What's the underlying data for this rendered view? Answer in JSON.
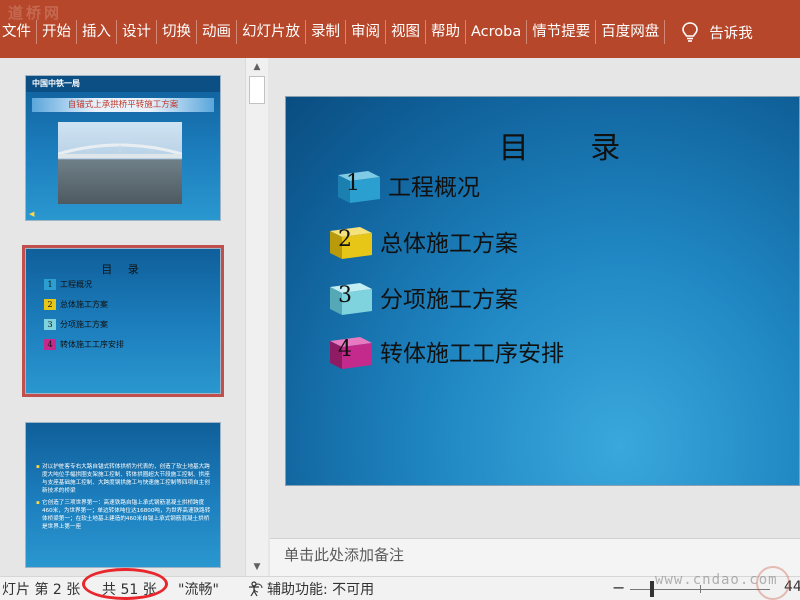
{
  "ribbon": {
    "watermark": "道桥网",
    "tabs": [
      "文件",
      "开始",
      "插入",
      "设计",
      "切换",
      "动画",
      "幻灯片放",
      "录制",
      "审阅",
      "视图",
      "帮助",
      "Acroba",
      "情节提要",
      "百度网盘"
    ],
    "tell_me": "告诉我",
    "color": "#b7472a"
  },
  "thumbnails": {
    "slide1": {
      "header": "中国中铁一局",
      "banner": "自锚式上承拱桥平转施工方案"
    },
    "slide2": {
      "title": "目 录",
      "items": [
        {
          "num": "1",
          "text": "工程概况"
        },
        {
          "num": "2",
          "text": "总体施工方案"
        },
        {
          "num": "3",
          "text": "分项施工方案"
        },
        {
          "num": "4",
          "text": "转体施工工序安排"
        }
      ]
    },
    "slide3": {
      "bullets": [
        "对以护桩客专右大路自锚式转体拱桥为代表的，创造了软土地基大跨度大吨位手幅拱圈支架施工控制、转体拱圈超大节段施工控制、拱座与支座基础施工控制、大跨度钢拱施工与快速施工控制等四项自主创新技术的桥梁",
        "它创造了三项世界第一：高速铁路自锚上承式钢筋混凝土拱桥跨度460米，为世界第一；单边转体吨位达16800吨，为世界高速铁路转体桥梁第一；在软土地基上建造的460米自锚上承式钢筋混凝土拱桥是世界上第一座"
      ]
    }
  },
  "slide": {
    "title": "目  录",
    "items": [
      {
        "num": "1",
        "text": "工程概况",
        "cube_color": "#2a9fd0"
      },
      {
        "num": "2",
        "text": "总体施工方案",
        "cube_color": "#e8c617"
      },
      {
        "num": "3",
        "text": "分项施工方案",
        "cube_color": "#7fd3de"
      },
      {
        "num": "4",
        "text": "转体施工工序安排",
        "cube_color": "#c42a8c"
      }
    ]
  },
  "notes": {
    "placeholder": "单击此处添加备注"
  },
  "statusbar": {
    "slide_label": "灯片 第 2 张",
    "total_label": "共 51 张",
    "theme_label": "\"流畅\"",
    "accessibility_label": "辅助功能: 不可用",
    "zoom_label": "44",
    "site_watermark": "www.cndao.com"
  }
}
